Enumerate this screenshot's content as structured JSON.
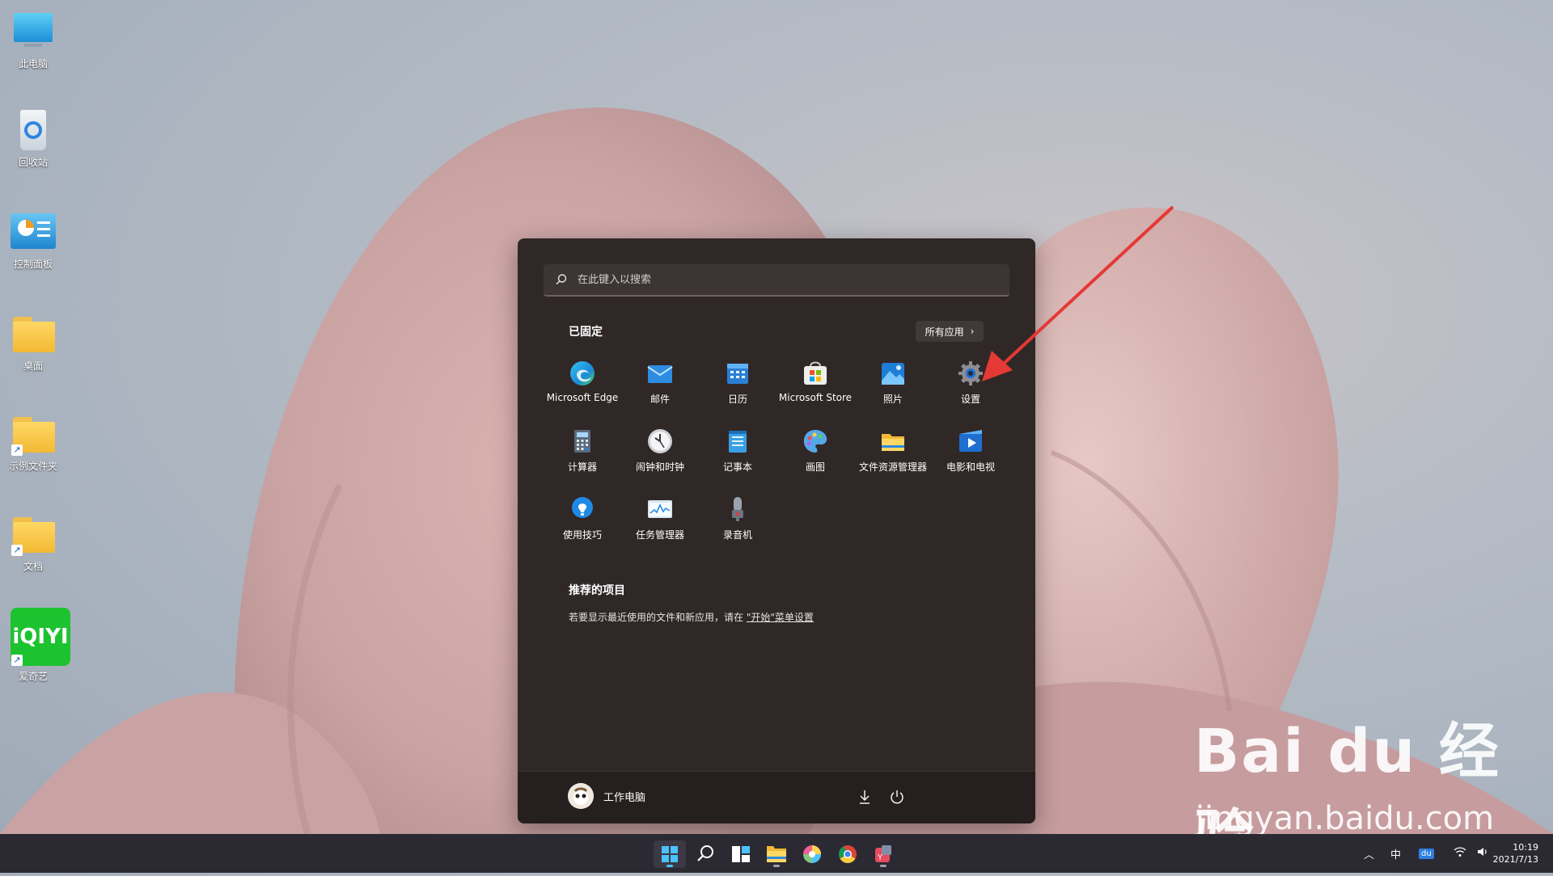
{
  "desktop": {
    "icons": [
      {
        "label": "此电脑",
        "icon": "monitor-icon"
      },
      {
        "label": "回收站",
        "icon": "recycle-bin-icon"
      },
      {
        "label": "控制面板",
        "icon": "control-panel-icon"
      },
      {
        "label": "桌面",
        "icon": "folder-icon"
      },
      {
        "label": "示例文件夹",
        "icon": "folder-shortcut-icon"
      },
      {
        "label": "文档",
        "icon": "folder-shortcut-icon"
      },
      {
        "label": "爱奇艺",
        "icon": "iqiyi-icon"
      }
    ]
  },
  "start_menu": {
    "search_placeholder": "在此键入以搜索",
    "pinned_title": "已固定",
    "all_apps_label": "所有应用",
    "pinned_apps": [
      {
        "label": "Microsoft Edge",
        "icon": "edge-icon"
      },
      {
        "label": "邮件",
        "icon": "mail-icon"
      },
      {
        "label": "日历",
        "icon": "calendar-icon"
      },
      {
        "label": "Microsoft Store",
        "icon": "store-icon"
      },
      {
        "label": "照片",
        "icon": "photos-icon"
      },
      {
        "label": "设置",
        "icon": "gear-icon"
      },
      {
        "label": "计算器",
        "icon": "calculator-icon"
      },
      {
        "label": "闹钟和时钟",
        "icon": "clock-icon"
      },
      {
        "label": "记事本",
        "icon": "notepad-icon"
      },
      {
        "label": "画图",
        "icon": "paint-icon"
      },
      {
        "label": "文件资源管理器",
        "icon": "file-explorer-icon"
      },
      {
        "label": "电影和电视",
        "icon": "movies-icon"
      },
      {
        "label": "使用技巧",
        "icon": "tips-icon"
      },
      {
        "label": "任务管理器",
        "icon": "task-manager-icon"
      },
      {
        "label": "录音机",
        "icon": "voice-recorder-icon"
      }
    ],
    "recommended_title": "推荐的项目",
    "recommended_text": "若要显示最近使用的文件和新应用，请在",
    "recommended_link": "\"开始\"菜单设置",
    "user_name": "工作电脑"
  },
  "taskbar": {
    "tray_ime": "中",
    "tray_du": "du",
    "time": "10:19",
    "date": "2021/7/13"
  },
  "watermark": {
    "brand": "Bai du 经验",
    "url": "jingyan.baidu.com"
  },
  "colors": {
    "start_bg": "#302727",
    "accent": "#0078d4",
    "annotation_arrow": "#e53935"
  }
}
